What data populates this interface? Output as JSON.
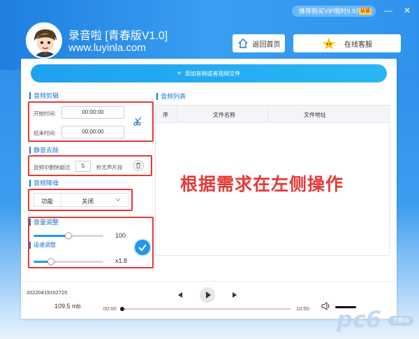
{
  "window": {
    "promo_text": "推荐购买VIP限时9.9元",
    "promo_tag": "认证",
    "minimize": "—",
    "close": "✕"
  },
  "header": {
    "app_title": "录音啦 [青春版V1.0]",
    "app_url": "www.luyinla.com",
    "home_button": "返回首页",
    "service_button": "在线客服"
  },
  "main": {
    "add_file_button": "添加音频或者视频文件",
    "audio_edit": {
      "title": "音频剪辑",
      "start_label": "开始时间:",
      "start_value": "00:00:00",
      "end_label": "结束时间:",
      "end_value": "00:00:00"
    },
    "silence_remove": {
      "title": "静音去除",
      "prefix": "音频中删除超过",
      "seconds": "5",
      "suffix": "秒无声片段"
    },
    "noise_reduce": {
      "title": "音频降噪",
      "function_label": "功能",
      "selected": "关闭"
    },
    "volume": {
      "title": "音量调整",
      "value": "100",
      "level": 0.5
    },
    "speed": {
      "title": "语速调整",
      "value": "x1.8",
      "level": 0.25
    },
    "audio_list": {
      "title": "音频列表",
      "columns": [
        "序",
        "文件名称",
        "文件地址"
      ]
    }
  },
  "overlay": {
    "annotation": "根据需求在左侧操作"
  },
  "player": {
    "file_name": "20220419102720",
    "file_size": "109.5 mb",
    "time_start": "00:00",
    "time_end": "10:50",
    "progress": 0
  },
  "watermark": {
    "text": "pc6",
    "sub": "下载站"
  },
  "colors": {
    "accent": "#1976d2",
    "annotation_red": "#e53935"
  }
}
